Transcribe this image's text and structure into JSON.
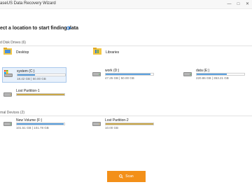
{
  "window": {
    "title": "aseUS Data Recovery Wizard"
  },
  "main": {
    "heading": "ect a location to start finding data",
    "refresh_icon": "refresh-icon"
  },
  "sections": {
    "hard_disk_drives": {
      "title": "d Disk Drives (6)"
    },
    "external_devices": {
      "title": "rnal Devices (2)"
    }
  },
  "locations": [
    {
      "label": "Desktop",
      "icon": "desktop-folder-icon"
    },
    {
      "label": "Libraries",
      "icon": "libraries-folder-icon"
    }
  ],
  "drives": [
    {
      "label": "system (C:)",
      "size": "18.42 GB | 50.00 GB",
      "used_fraction": 0.37,
      "bar_color": "#5aa0e0",
      "selected": true,
      "icon": "system-drive-icon"
    },
    {
      "label": "work (D:)",
      "size": "47.25 GB | 50.00 GB",
      "used_fraction": 0.94,
      "bar_color": "#5aa0e0",
      "selected": false,
      "icon": "hard-drive-icon"
    },
    {
      "label": "data (E:)",
      "size": "220.86 GB | 353.21 GB",
      "used_fraction": 0.63,
      "bar_color": "#5aa0e0",
      "selected": false,
      "icon": "hard-drive-icon"
    },
    {
      "label": "Lost Partition-1",
      "size": "",
      "used_fraction": 1.0,
      "bar_color": "#c9a646",
      "selected": false,
      "icon": "lost-partition-icon"
    }
  ],
  "external": [
    {
      "label": "New Volume (F:)",
      "size": "101.51 GB | 101.78 GB",
      "used_fraction": 0.99,
      "bar_color": "#5aa0e0",
      "icon": "removable-drive-icon"
    },
    {
      "label": "Lost Partition-2",
      "size": "10.00 GB",
      "used_fraction": 1.0,
      "bar_color": "#c9a646",
      "icon": "lost-partition-icon"
    }
  ],
  "actions": {
    "scan_label": "Scan",
    "scan_icon": "search-icon",
    "accent_color": "#f39019"
  },
  "titlebar_controls": {
    "minimize": "—",
    "maximize": "□",
    "close": "✕"
  }
}
